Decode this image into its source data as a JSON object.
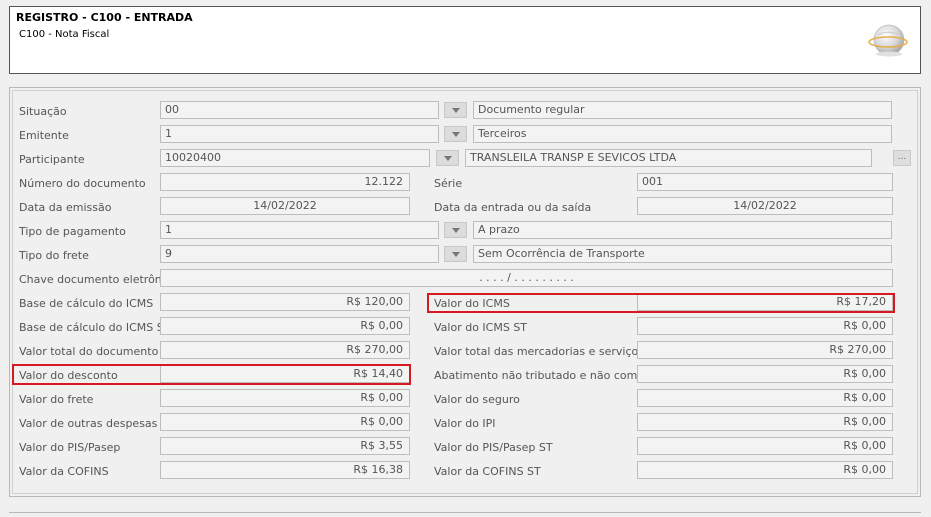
{
  "header": {
    "title": "REGISTRO - C100 - ENTRADA",
    "subtitle": "C100 - Nota Fiscal",
    "logo_icon": "globe-logo-icon"
  },
  "form": {
    "situacao": {
      "label": "Situação",
      "code": "00",
      "desc": "Documento regular"
    },
    "emitente": {
      "label": "Emitente",
      "code": "1",
      "desc": "Terceiros"
    },
    "participante": {
      "label": "Participante",
      "code": "10020400",
      "desc": "TRANSLEILA TRANSP E SEVICOS LTDA",
      "button": "..."
    },
    "numero_documento": {
      "label": "Número do documento",
      "value": "12.122"
    },
    "serie": {
      "label": "Série",
      "value": "001"
    },
    "data_emissao": {
      "label": "Data da emissão",
      "value": "14/02/2022"
    },
    "data_entrada": {
      "label": "Data da entrada ou da saída",
      "value": "14/02/2022"
    },
    "tipo_pagamento": {
      "label": "Tipo de pagamento",
      "code": "1",
      "desc": "A prazo"
    },
    "tipo_frete": {
      "label": "Tipo do frete",
      "code": "9",
      "desc": "Sem Ocorrência de Transporte"
    },
    "chave": {
      "label": "Chave documento eletrônico",
      "value": ". . . . /  . . . . . . . . ."
    },
    "base_icms": {
      "label": "Base de cálculo do ICMS",
      "value": "R$ 120,00"
    },
    "valor_icms": {
      "label": "Valor do ICMS",
      "value": "R$ 17,20"
    },
    "base_icms_st": {
      "label": "Base de cálculo do ICMS ST",
      "value": "R$ 0,00"
    },
    "valor_icms_st": {
      "label": "Valor do ICMS ST",
      "value": "R$ 0,00"
    },
    "valor_total_doc": {
      "label": "Valor total do documento",
      "value": "R$ 270,00"
    },
    "valor_total_merc": {
      "label": "Valor total das mercadorias e serviços",
      "value": "R$ 270,00"
    },
    "valor_desconto": {
      "label": "Valor do desconto",
      "value": "R$ 14,40"
    },
    "abatimento": {
      "label": "Abatimento não tributado e não comercial",
      "value": "R$ 0,00"
    },
    "valor_frete": {
      "label": "Valor do frete",
      "value": "R$ 0,00"
    },
    "valor_seguro": {
      "label": "Valor do seguro",
      "value": "R$ 0,00"
    },
    "outras_despesas": {
      "label": "Valor de outras despesas",
      "value": "R$ 0,00"
    },
    "valor_ipi": {
      "label": "Valor do IPI",
      "value": "R$ 0,00"
    },
    "pis_pasep": {
      "label": "Valor do PIS/Pasep",
      "value": "R$ 3,55"
    },
    "pis_pasep_st": {
      "label": "Valor do PIS/Pasep ST",
      "value": "R$ 0,00"
    },
    "cofins": {
      "label": "Valor da COFINS",
      "value": "R$ 16,38"
    },
    "cofins_st": {
      "label": "Valor da COFINS ST",
      "value": "R$ 0,00"
    }
  },
  "colors": {
    "highlight": "#d51a22"
  }
}
